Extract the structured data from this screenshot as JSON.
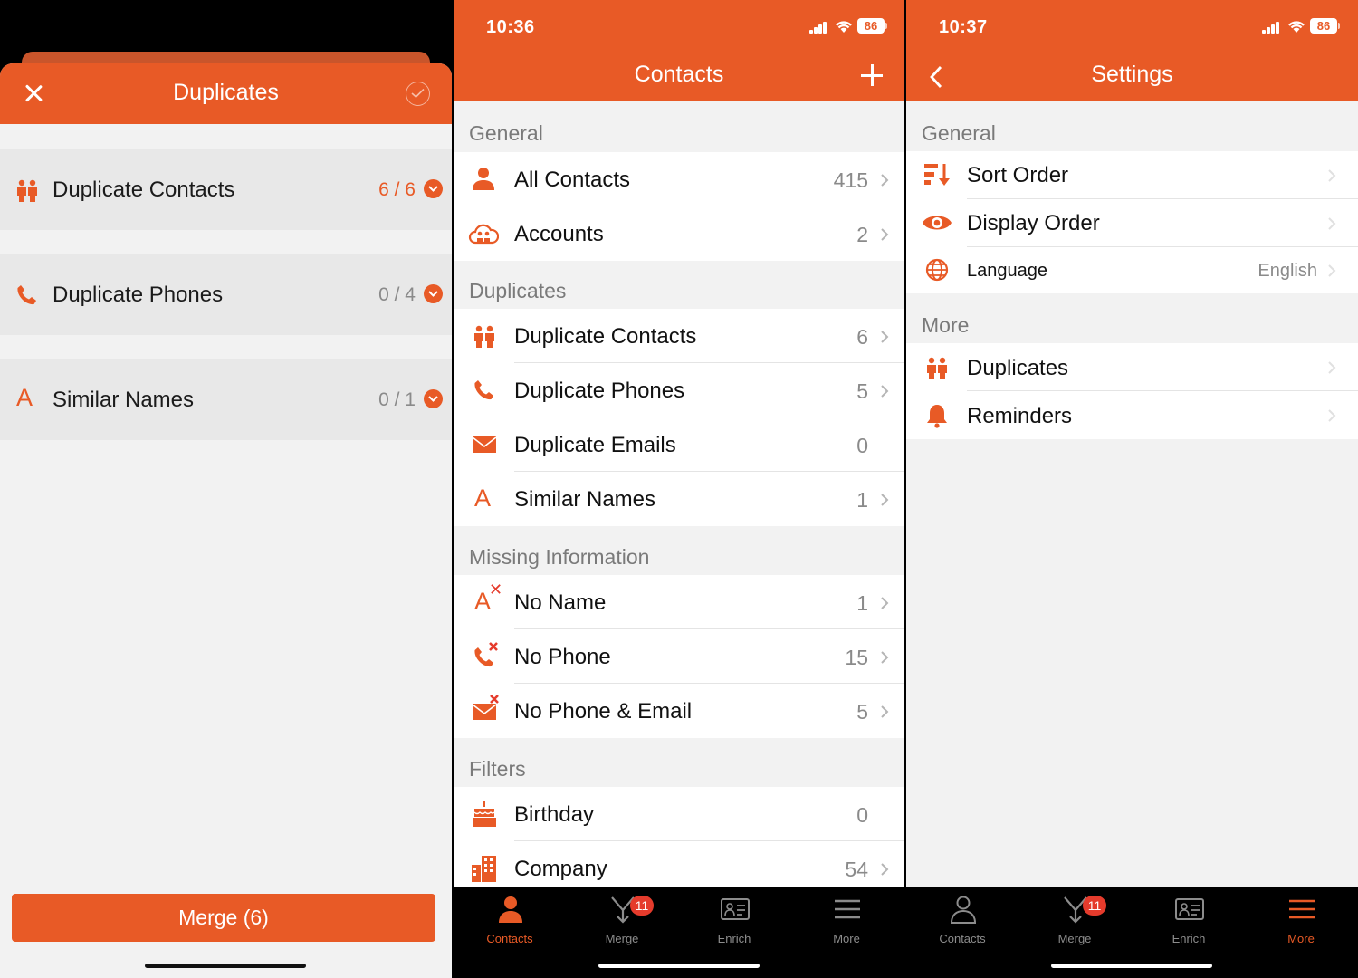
{
  "colors": {
    "accent": "#e85a26",
    "badge": "#e53b2c"
  },
  "panel1": {
    "title": "Duplicates",
    "rows": [
      {
        "label": "Duplicate Contacts",
        "count": "6 / 6",
        "icon": "people-icon"
      },
      {
        "label": "Duplicate Phones",
        "count": "0 / 4",
        "icon": "phone-icon"
      },
      {
        "label": "Similar Names",
        "count": "0 / 1",
        "icon": "letter-a-icon"
      }
    ],
    "merge_label": "Merge (6)"
  },
  "panel2": {
    "time": "10:36",
    "battery": "86",
    "title": "Contacts",
    "sections": {
      "general": "General",
      "duplicates": "Duplicates",
      "missing": "Missing Information",
      "filters": "Filters"
    },
    "items": {
      "all_contacts": {
        "label": "All Contacts",
        "value": "415"
      },
      "accounts": {
        "label": "Accounts",
        "value": "2"
      },
      "dup_contacts": {
        "label": "Duplicate Contacts",
        "value": "6"
      },
      "dup_phones": {
        "label": "Duplicate Phones",
        "value": "5"
      },
      "dup_emails": {
        "label": "Duplicate Emails",
        "value": "0"
      },
      "similar_names": {
        "label": "Similar Names",
        "value": "1"
      },
      "no_name": {
        "label": "No Name",
        "value": "1"
      },
      "no_phone": {
        "label": "No Phone",
        "value": "15"
      },
      "no_phone_email": {
        "label": "No Phone & Email",
        "value": "5"
      },
      "birthday": {
        "label": "Birthday",
        "value": "0"
      },
      "company": {
        "label": "Company",
        "value": "54"
      }
    }
  },
  "panel3": {
    "time": "10:37",
    "battery": "86",
    "title": "Settings",
    "sections": {
      "general": "General",
      "more": "More"
    },
    "items": {
      "sort_order": {
        "label": "Sort Order"
      },
      "display_order": {
        "label": "Display Order"
      },
      "language": {
        "label": "Language",
        "value": "English"
      },
      "duplicates": {
        "label": "Duplicates"
      },
      "reminders": {
        "label": "Reminders"
      }
    }
  },
  "tabbar": {
    "contacts": "Contacts",
    "merge": "Merge",
    "merge_badge": "11",
    "enrich": "Enrich",
    "more": "More"
  }
}
